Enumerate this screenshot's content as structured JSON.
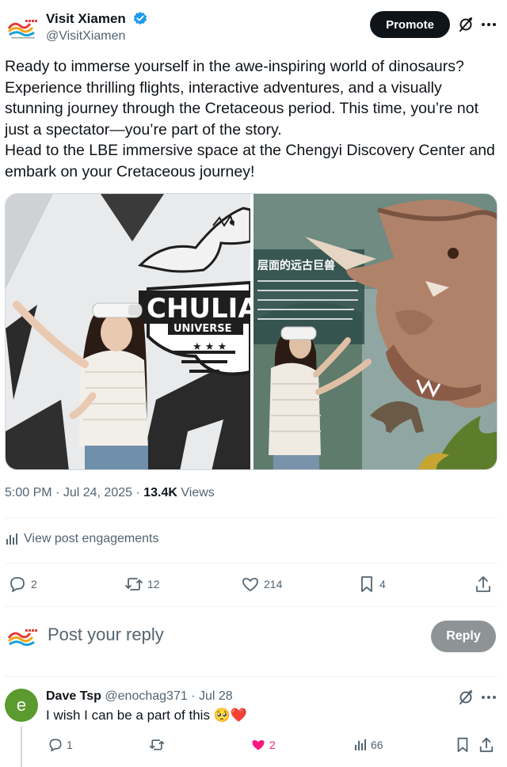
{
  "post": {
    "author_name": "Visit Xiamen",
    "author_handle": "@VisitXiamen",
    "promote_label": "Promote",
    "text_lines": [
      "Ready to immerse yourself in the awe-inspiring world of dinosaurs?",
      "Experience thrilling flights, interactive adventures, and a visually stunning journey through the Cretaceous period. This time, you’re not just a spectator—you’re part of the story.",
      "Head to the LBE immersive space at the Chengyi Discovery Center and embark on your Cretaceous journey!"
    ],
    "media": {
      "left_logo_line1": "CHULIA",
      "left_logo_line2": "UNIVERSE",
      "left_logo_stars": "★ ★ ★",
      "right_sign_title": "层面的远古巨兽"
    },
    "time": "5:00 PM",
    "date": "Jul 24, 2025",
    "views_count": "13.4K",
    "views_label": "Views",
    "engagements_label": "View post engagements",
    "stats": {
      "replies": "2",
      "reposts": "12",
      "likes": "214",
      "bookmarks": "4"
    }
  },
  "composer": {
    "placeholder": "Post your reply",
    "reply_label": "Reply"
  },
  "comment": {
    "avatar_letter": "e",
    "name": "Dave Tsp",
    "handle": "@enochag371",
    "date": "Jul 28",
    "text": "I wish I can be a part  of this",
    "emojis": "🥺❤️",
    "replies": "1",
    "likes": "2",
    "views": "66"
  },
  "colors": {
    "text_primary": "#0f1419",
    "text_secondary": "#536471",
    "verified_blue": "#1d9bf0",
    "like_pink": "#f91880",
    "divider": "#eff3f4"
  },
  "icons": [
    "verified-badge-icon",
    "grok-icon",
    "more-icon",
    "analytics-icon",
    "reply-icon",
    "repost-icon",
    "like-icon",
    "bookmark-icon",
    "share-icon"
  ]
}
